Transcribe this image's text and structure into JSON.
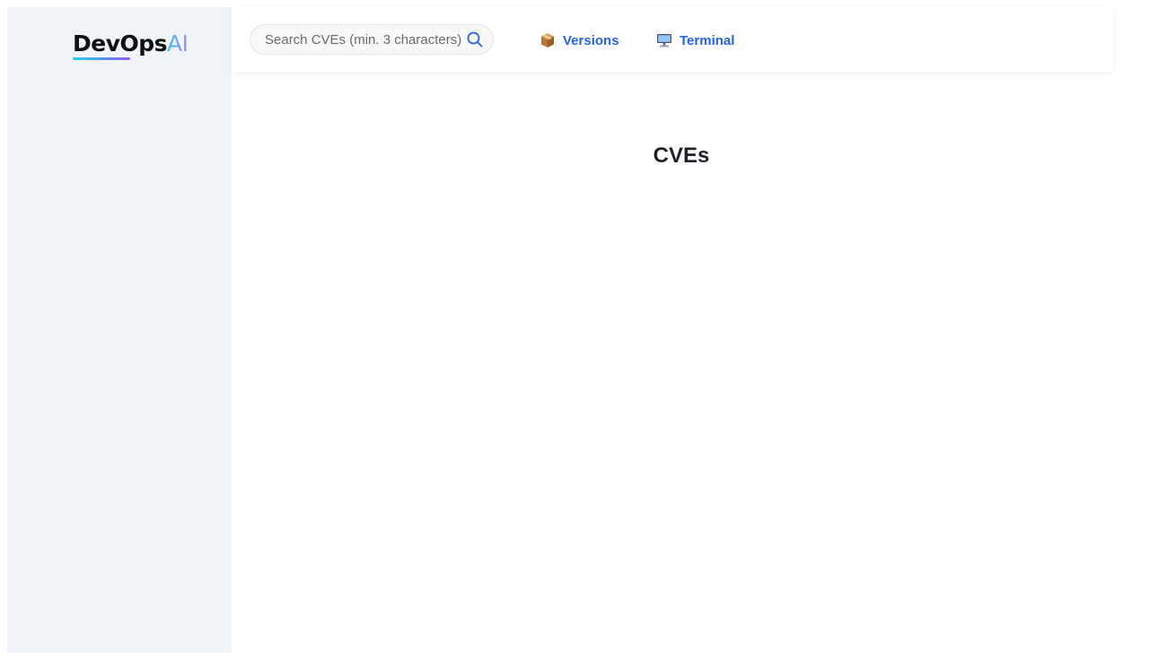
{
  "brand": {
    "name_main": "DevOps",
    "name_accent": "AI"
  },
  "search": {
    "placeholder": "Search CVEs (min. 3 characters)",
    "value": ""
  },
  "nav": {
    "versions": {
      "label": "Versions",
      "icon": "package-icon"
    },
    "terminal": {
      "label": "Terminal",
      "icon": "computer-icon"
    }
  },
  "main": {
    "title": "CVEs"
  },
  "colors": {
    "sidebar_bg": "#f0f4f9",
    "link": "#2563eb",
    "title": "#1f2329"
  }
}
